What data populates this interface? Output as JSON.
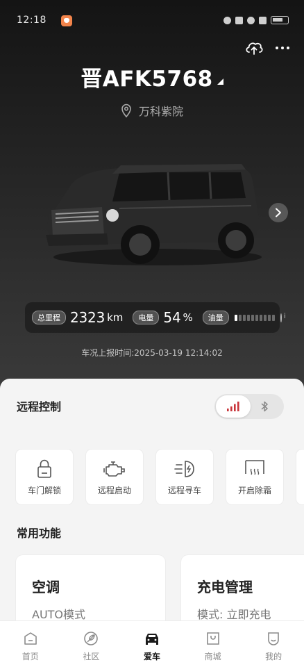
{
  "status_bar": {
    "time": "12:18"
  },
  "vehicle": {
    "plate": "晋AFK5768",
    "location": "万科紫院"
  },
  "stats": {
    "mileage_label": "总里程",
    "mileage_value": "2323",
    "mileage_unit": "km",
    "battery_label": "电量",
    "battery_value": "54",
    "battery_unit": "%",
    "fuel_label": "油量",
    "fuel_level_fraction": 0.1
  },
  "report_time": "车况上报时间:2025-03-19 12:14:02",
  "remote": {
    "title": "远程控制",
    "controls": [
      {
        "label": "车门解锁",
        "icon": "lock-icon"
      },
      {
        "label": "远程启动",
        "icon": "engine-icon"
      },
      {
        "label": "远程寻车",
        "icon": "headlight-icon"
      },
      {
        "label": "开启除霜",
        "icon": "defrost-icon"
      }
    ]
  },
  "common": {
    "title": "常用功能",
    "cards": [
      {
        "title": "空调",
        "subtitle": "AUTO模式"
      },
      {
        "title": "充电管理",
        "subtitle": "模式: 立即充电"
      }
    ]
  },
  "tabs": [
    {
      "label": "首页",
      "icon": "home-icon"
    },
    {
      "label": "社区",
      "icon": "leaf-icon"
    },
    {
      "label": "爱车",
      "icon": "car-icon",
      "active": true
    },
    {
      "label": "商城",
      "icon": "shop-icon"
    },
    {
      "label": "我的",
      "icon": "profile-icon"
    }
  ],
  "colors": {
    "accent_red": "#c8343a",
    "hero_top": "#141414",
    "hero_bottom": "#3b3b3b"
  }
}
